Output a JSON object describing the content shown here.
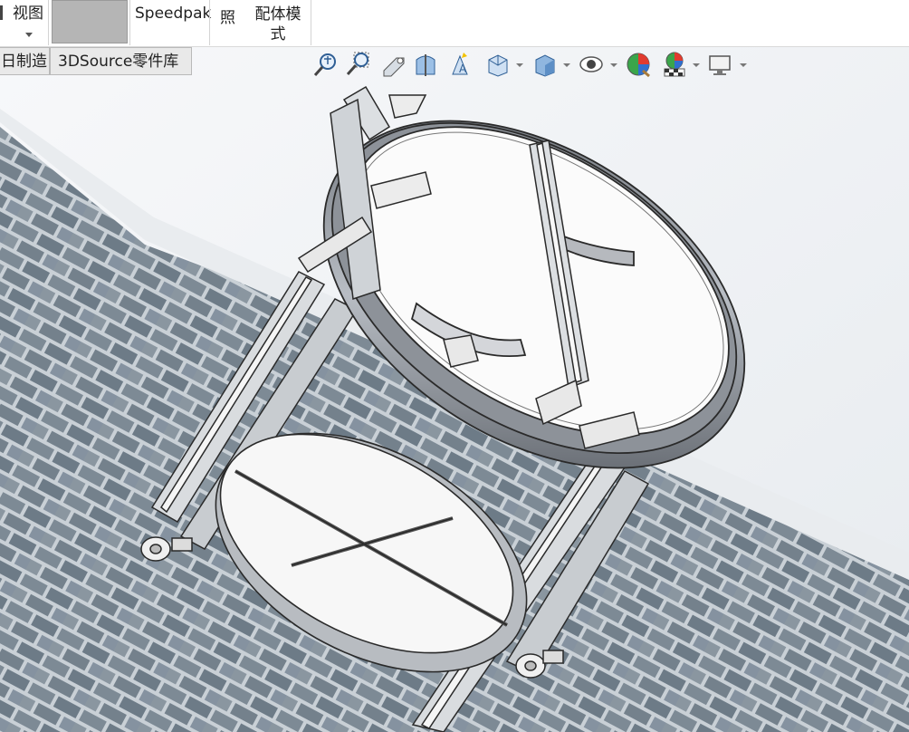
{
  "ribbon": {
    "view_label": "视图",
    "speedpak_label": "Speedpak",
    "photo_label": "照",
    "assembly_mode_label_line1": "配体模",
    "assembly_mode_label_line2": "式"
  },
  "tabs": [
    {
      "label": "日制造"
    },
    {
      "label": "3DSource零件库"
    }
  ],
  "hud_icons": [
    "zoom-to-fit-icon",
    "zoom-to-area-icon",
    "previous-view-icon",
    "section-view-icon",
    "dynamic-annotation-views-icon",
    "view-orientation-icon",
    "display-style-icon",
    "hide-show-items-icon",
    "edit-appearance-icon",
    "apply-scene-icon",
    "view-settings-icon"
  ],
  "colors": {
    "ribbon_bg": "#ffffff",
    "tab_bg": "#e9e9e9",
    "viewport_bg": "#eef1f4",
    "brick": "#7d8a95",
    "mortar": "#c9d0d6",
    "model_line": "#2a2a2a",
    "model_fill": "#f2f2f2",
    "model_shade": "#9aa0a8"
  }
}
